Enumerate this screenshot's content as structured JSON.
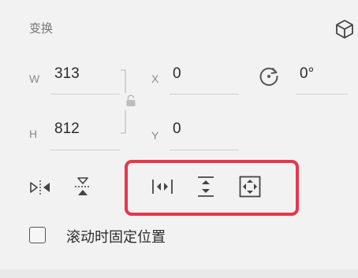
{
  "transform": {
    "title": "变换",
    "view_icon": "cube-3d-icon",
    "width": {
      "label": "W",
      "value": "313"
    },
    "height": {
      "label": "H",
      "value": "812"
    },
    "x": {
      "label": "X",
      "value": "0"
    },
    "y": {
      "label": "Y",
      "value": "0"
    },
    "rotation": {
      "icon": "rotate-icon",
      "value": "0°"
    },
    "lock_icon": "lock-icon"
  },
  "tools": {
    "flip_horizontal": "flip-horizontal-icon",
    "flip_vertical": "flip-vertical-icon",
    "stretch_horizontal": "stretch-horizontal-icon",
    "stretch_vertical": "stretch-vertical-icon",
    "stretch_both": "stretch-both-icon"
  },
  "highlight_color": "#e8364a",
  "fixed_on_scroll": {
    "label": "滚动时固定位置",
    "checked": false
  }
}
